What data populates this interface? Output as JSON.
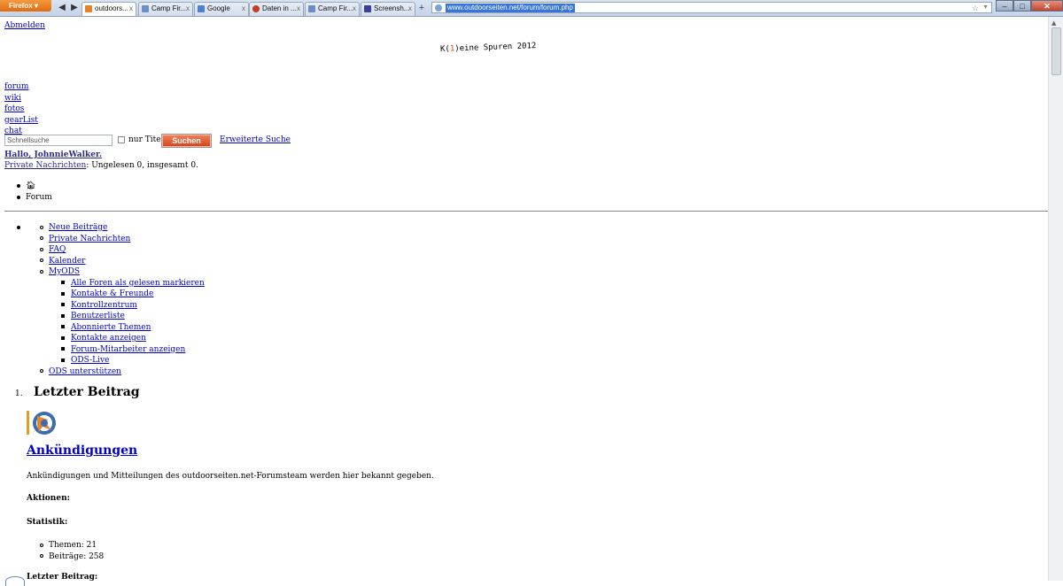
{
  "browser": {
    "app_button": "Firefox",
    "tabs": [
      {
        "label": "outdoors...",
        "icon_color": "#e0832a",
        "active": true
      },
      {
        "label": "Camp Fir...",
        "icon_color": "#6d8fbf",
        "active": false
      },
      {
        "label": "Google",
        "icon_color": "#4f7fd0",
        "active": false
      },
      {
        "label": "Daten in ...",
        "icon_color": "#c43a2a",
        "active": false
      },
      {
        "label": "Camp Fir...",
        "icon_color": "#6d8fbf",
        "active": false
      },
      {
        "label": "Screensh...",
        "icon_color": "#3d3f9c",
        "active": false
      }
    ],
    "new_tab": "+",
    "url": "www.outdoorseiten.net/forum/forum.php",
    "window_buttons": {
      "minimize": "–",
      "maximize": "□",
      "close": "✕"
    }
  },
  "page": {
    "logout": "Abmelden",
    "logo": {
      "before": "K(",
      "one": "1",
      "after": ")eine Spuren 2012"
    },
    "main_nav": [
      "forum",
      "wiki",
      "fotos",
      "gearList",
      "chat"
    ],
    "search": {
      "placeholder": "Schnellsuche",
      "title_only_label": "nur Titel",
      "button": "Suchen",
      "advanced": "Erweiterte Suche"
    },
    "greeting": "Hallo, JohnnieWalker.",
    "pm_link": "Private Nachrichten",
    "pm_status": ": Ungelesen 0, insgesamt 0.",
    "breadcrumb": {
      "home_icon": "home-icon",
      "current": "Forum"
    },
    "menu": {
      "items": [
        "Neue Beiträge",
        "Private Nachrichten",
        "FAQ",
        "Kalender",
        "MyODS"
      ],
      "myods_items": [
        "Alle Foren als gelesen markieren",
        "Kontakte & Freunde",
        "Kontrollzentrum",
        "Benutzerliste",
        "Abonnierte Themen",
        "Kontakte anzeigen",
        "Forum-Mitarbeiter anzeigen",
        "ODS-Live"
      ],
      "last_item": "ODS unterstützen"
    },
    "section": {
      "number": "1.",
      "title": "Letzter Beitrag",
      "forum_title": "Ankündigungen",
      "forum_desc": "Ankündigungen und Mitteilungen des outdoorseiten.net-Forumsteam werden hier bekannt gegeben.",
      "aktionen": "Aktionen:",
      "statistik": "Statistik:",
      "stats": [
        "Themen: 21",
        "Beiträge: 258"
      ],
      "next_letzter": "Letzter Beitrag:"
    }
  }
}
